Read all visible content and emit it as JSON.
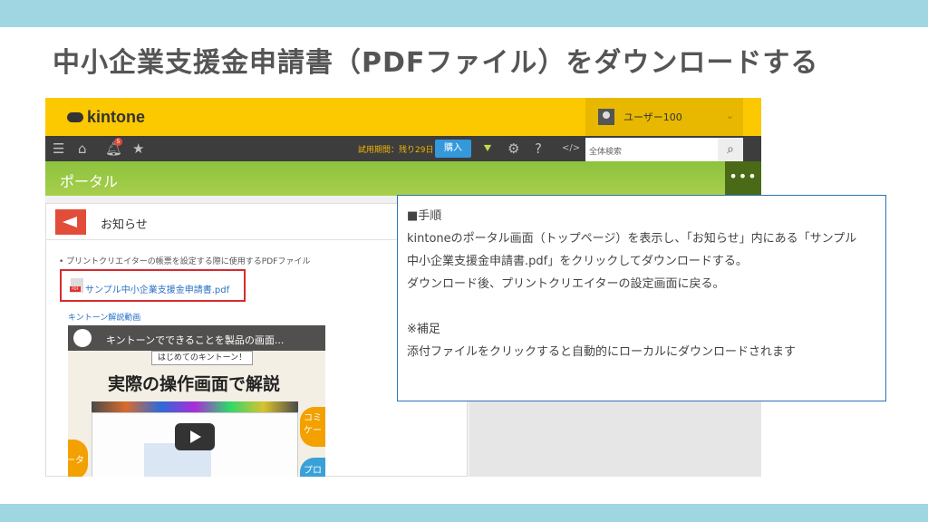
{
  "slide": {
    "title": "中小企業支援金申請書（PDFファイル）をダウンロードする"
  },
  "kintone": {
    "logo_text": "kintone",
    "user_name": "ユーザー100",
    "trial_text": "試用期間：残り29日",
    "buy_label": "購入",
    "search_placeholder": "全体検索",
    "notification_count": "5",
    "portal_label": "ポータル",
    "more_label": "•••"
  },
  "news": {
    "title": "お知らせ",
    "line": "• プリントクリエイターの帳票を設定する際に使用するPDFファイル",
    "file_link": "サンプル中小企業支援金申請書.pdf",
    "pdf_tag": "PDF",
    "video_label": "キントーン解説動画"
  },
  "video": {
    "title": "キントーンでできることを製品の画面...",
    "subtitle": "はじめてのキントーン！",
    "headline": "実際の操作画面で解説",
    "side_right": "コミ ケー",
    "side_left": "ータ",
    "side_right2": "プロセ 管"
  },
  "callout": {
    "lines": [
      "■手順",
      "kintoneのポータル画面（トップページ）を表示し、「お知らせ」内にある「サンプル",
      "中小企業支援金申請書.pdf」をクリックしてダウンロードする。",
      "ダウンロード後、プリントクリエイターの設定画面に戻る。",
      "",
      "※補足",
      "添付ファイルをクリックすると自動的にローカルにダウンロードされます"
    ]
  },
  "icons": {
    "menu": "menu-icon",
    "home": "home-icon",
    "bell": "bell-icon",
    "star": "star-icon",
    "beginner": "beginner-icon",
    "gear": "gear-icon",
    "help": "help-icon",
    "code": "code-icon",
    "search": "search-icon"
  },
  "colors": {
    "band": "#9fd6e2",
    "kintone_yellow": "#fcc800",
    "toolbar": "#3d3d3d",
    "portal_green": "#8dc23e",
    "link": "#2a72c4",
    "highlight": "#d62b2b",
    "callout_border": "#2c74b8"
  }
}
